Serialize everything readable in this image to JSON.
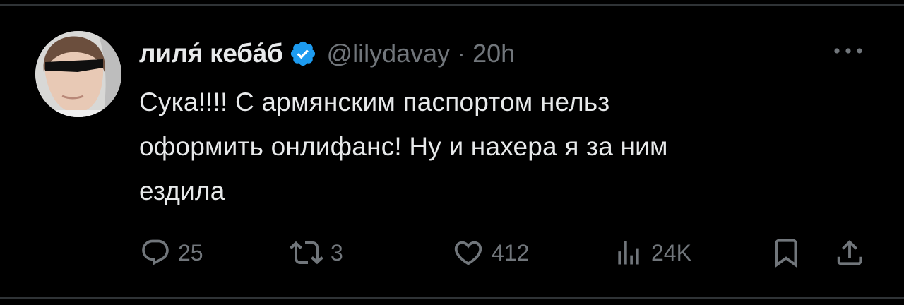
{
  "tweet": {
    "author": {
      "display_name": "лиля́ кеба́б",
      "handle": "@lilydavay",
      "verified": true,
      "avatar_icon": "user-avatar"
    },
    "separator": "·",
    "time": "20h",
    "lines": [
      "Сука!!!! С армянским паспортом нельз",
      "оформить онлифанс! Ну и нахера я за ним",
      "ездила"
    ],
    "more_icon": "more-horizontal-icon"
  },
  "actions": {
    "reply": {
      "icon": "reply-icon",
      "count": "25"
    },
    "retweet": {
      "icon": "retweet-icon",
      "count": "3"
    },
    "like": {
      "icon": "heart-icon",
      "count": "412"
    },
    "views": {
      "icon": "views-icon",
      "count": "24K"
    },
    "bookmark": {
      "icon": "bookmark-icon"
    },
    "share": {
      "icon": "share-icon"
    }
  },
  "colors": {
    "background": "#000000",
    "text": "#e7e9ea",
    "muted": "#71767b",
    "verified": "#1d9bf0",
    "divider": "#2f3336"
  }
}
